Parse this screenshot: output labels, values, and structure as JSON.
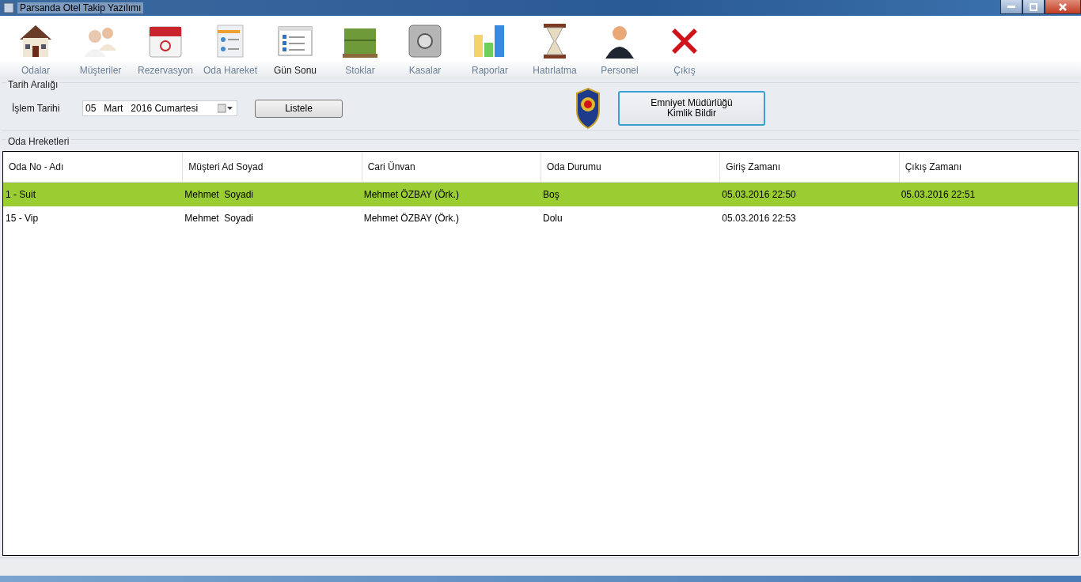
{
  "window": {
    "title": "Parsanda Otel Takip Yazılımı"
  },
  "toolbar": [
    {
      "kind": "house",
      "label": "Odalar",
      "selected": false
    },
    {
      "kind": "people",
      "label": "Müşteriler",
      "selected": false
    },
    {
      "kind": "calendar",
      "label": "Rezervasyon",
      "selected": false
    },
    {
      "kind": "document",
      "label": "Oda Hareket",
      "selected": false
    },
    {
      "kind": "list",
      "label": "Gün Sonu",
      "selected": true
    },
    {
      "kind": "boxes",
      "label": "Stoklar",
      "selected": false
    },
    {
      "kind": "safe",
      "label": "Kasalar",
      "selected": false
    },
    {
      "kind": "chart",
      "label": "Raporlar",
      "selected": false
    },
    {
      "kind": "hourglass",
      "label": "Hatırlatma",
      "selected": false
    },
    {
      "kind": "person",
      "label": "Personel",
      "selected": false
    },
    {
      "kind": "exit",
      "label": "Çıkış",
      "selected": false
    }
  ],
  "date_range": {
    "title": "Tarih Aralığı",
    "label": "İşlem Tarihi",
    "day": "05",
    "month": "Mart",
    "year_weekday": "2016 Cumartesi",
    "list_button": "Listele",
    "police_button": [
      "Emniyet Müdürlüğü",
      "Kimlik Bildir"
    ]
  },
  "movements": {
    "title": "Oda Hreketleri",
    "columns": [
      "Oda No - Adı",
      "Müşteri Ad Soyad",
      "Cari Ünvan",
      "Oda Durumu",
      "Giriş Zamanı",
      "Çıkış Zamanı"
    ],
    "rows": [
      {
        "selected": true,
        "cells": [
          "1 - Suit",
          "Mehmet  Soyadi",
          "Mehmet ÖZBAY (Örk.)",
          "Boş",
          "05.03.2016 22:50",
          "05.03.2016 22:51"
        ]
      },
      {
        "selected": false,
        "cells": [
          "15 - Vip",
          "Mehmet  Soyadi",
          "Mehmet ÖZBAY (Örk.)",
          "Dolu",
          "05.03.2016 22:53",
          ""
        ]
      }
    ]
  }
}
